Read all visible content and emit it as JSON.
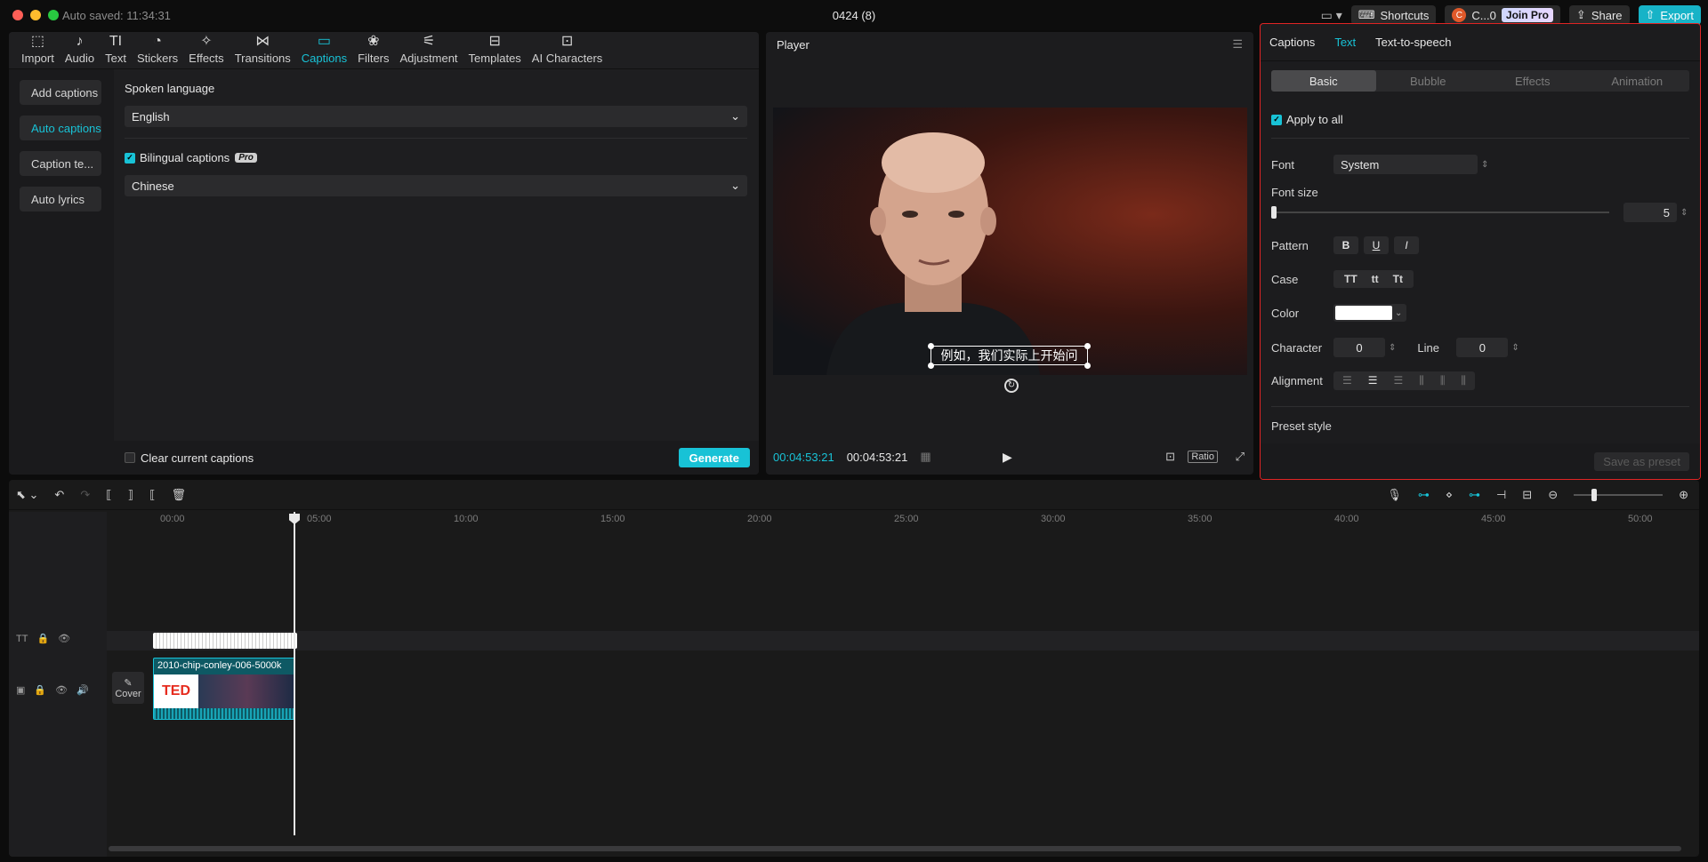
{
  "window": {
    "autosave": "Auto saved: 11:34:31",
    "title": "0424 (8)"
  },
  "header": {
    "shortcuts": "Shortcuts",
    "account": "C...0",
    "avatar_letter": "C",
    "join_pro": "Join Pro",
    "share": "Share",
    "export": "Export"
  },
  "toolbar": [
    {
      "label": "Import",
      "icon": "import-icon"
    },
    {
      "label": "Audio",
      "icon": "audio-icon"
    },
    {
      "label": "Text",
      "icon": "text-icon"
    },
    {
      "label": "Stickers",
      "icon": "stickers-icon"
    },
    {
      "label": "Effects",
      "icon": "effects-icon"
    },
    {
      "label": "Transitions",
      "icon": "transitions-icon"
    },
    {
      "label": "Captions",
      "icon": "captions-icon",
      "active": true
    },
    {
      "label": "Filters",
      "icon": "filters-icon"
    },
    {
      "label": "Adjustment",
      "icon": "adjustment-icon"
    },
    {
      "label": "Templates",
      "icon": "templates-icon"
    },
    {
      "label": "AI Characters",
      "icon": "ai-characters-icon"
    }
  ],
  "caption_sidebar": [
    "Add captions",
    "Auto captions",
    "Caption te...",
    "Auto lyrics"
  ],
  "auto_captions": {
    "spoken_language_label": "Spoken language",
    "spoken_language": "English",
    "bilingual_label": "Bilingual captions",
    "pro_badge": "Pro",
    "bilingual_language": "Chinese",
    "clear_label": "Clear current captions",
    "generate": "Generate"
  },
  "player": {
    "title": "Player",
    "subtitle": "例如，我们实际上开始问",
    "time_current": "00:04:53:21",
    "time_total": "00:04:53:21",
    "ratio": "Ratio"
  },
  "inspector": {
    "tabs": [
      "Captions",
      "Text",
      "Text-to-speech"
    ],
    "segments": [
      "Basic",
      "Bubble",
      "Effects",
      "Animation"
    ],
    "apply_all": "Apply to all",
    "font_label": "Font",
    "font_value": "System",
    "font_size_label": "Font size",
    "font_size_value": "5",
    "pattern_label": "Pattern",
    "pattern": [
      "B",
      "U",
      "I"
    ],
    "case_label": "Case",
    "case": [
      "TT",
      "tt",
      "Tt"
    ],
    "color_label": "Color",
    "color_value": "#ffffff",
    "character_label": "Character",
    "character_value": "0",
    "line_label": "Line",
    "line_value": "0",
    "alignment_label": "Alignment",
    "preset_label": "Preset style",
    "save_preset": "Save as preset"
  },
  "timeline": {
    "ruler": [
      "00:00",
      "05:00",
      "10:00",
      "15:00",
      "20:00",
      "25:00",
      "30:00",
      "35:00",
      "40:00",
      "45:00",
      "50:00"
    ],
    "clip_name": "2010-chip-conley-006-5000k",
    "cover": "Cover",
    "logo_text": "TED"
  },
  "colors": {
    "accent": "#18c2d6",
    "highlight_border": "#e02424"
  }
}
